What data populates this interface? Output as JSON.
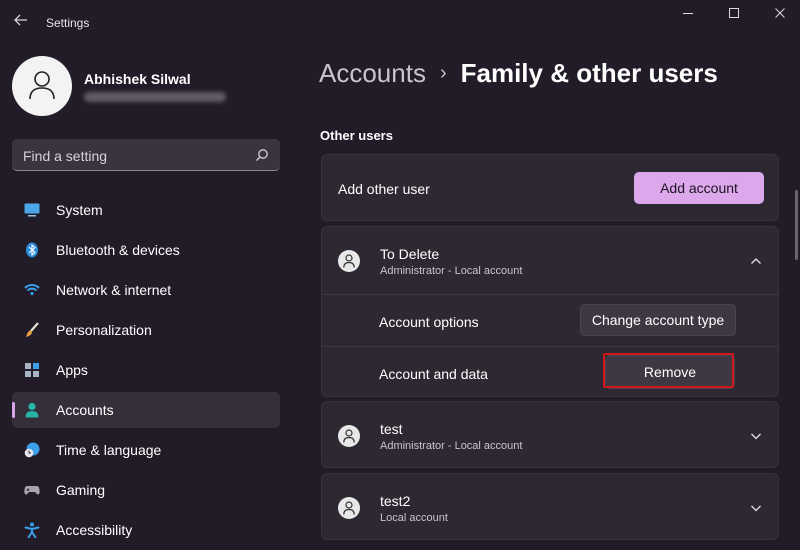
{
  "window": {
    "title": "Settings",
    "controls": {
      "minimize": "—",
      "maximize": "☐",
      "close": "✕"
    }
  },
  "profile": {
    "name": "Abhishek Silwal",
    "email_blurred": ""
  },
  "search": {
    "placeholder": "Find a setting"
  },
  "sidebar": {
    "items": [
      {
        "label": "System",
        "icon": "monitor-icon",
        "active": false
      },
      {
        "label": "Bluetooth & devices",
        "icon": "bluetooth-icon",
        "active": false
      },
      {
        "label": "Network & internet",
        "icon": "wifi-icon",
        "active": false
      },
      {
        "label": "Personalization",
        "icon": "brush-icon",
        "active": false
      },
      {
        "label": "Apps",
        "icon": "apps-icon",
        "active": false
      },
      {
        "label": "Accounts",
        "icon": "person-icon",
        "active": true
      },
      {
        "label": "Time & language",
        "icon": "clock-globe-icon",
        "active": false
      },
      {
        "label": "Gaming",
        "icon": "gamepad-icon",
        "active": false
      },
      {
        "label": "Accessibility",
        "icon": "accessibility-icon",
        "active": false
      }
    ]
  },
  "header": {
    "parent": "Accounts",
    "separator": "›",
    "current": "Family & other users"
  },
  "main": {
    "section_title": "Other users",
    "add_user": {
      "label": "Add other user",
      "button": "Add account"
    },
    "accounts": [
      {
        "name": "To Delete",
        "type": "Administrator - Local account",
        "expanded": true,
        "options": [
          {
            "label": "Account options",
            "button": "Change account type"
          },
          {
            "label": "Account and data",
            "button": "Remove"
          }
        ]
      },
      {
        "name": "test",
        "type": "Administrator - Local account",
        "expanded": false
      },
      {
        "name": "test2",
        "type": "Local account",
        "expanded": false
      }
    ]
  },
  "colors": {
    "background": "#221c29",
    "card": "#2e2833",
    "accent": "#dca7eb",
    "highlight": "#d2161c"
  }
}
